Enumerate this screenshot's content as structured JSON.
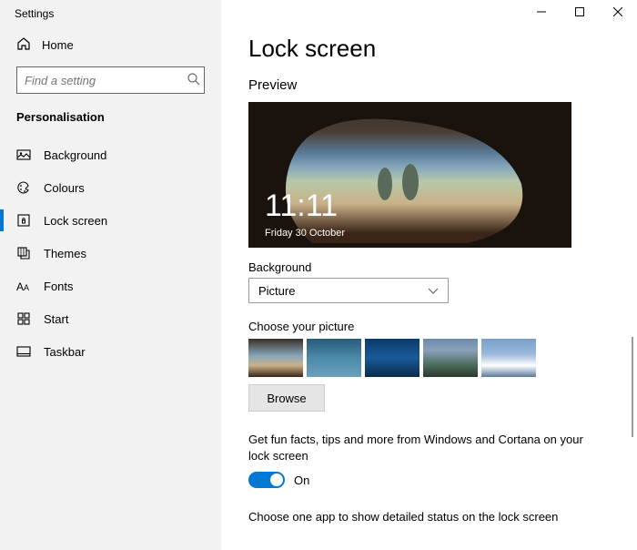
{
  "app_title": "Settings",
  "home_label": "Home",
  "search": {
    "placeholder": "Find a setting"
  },
  "category": "Personalisation",
  "nav": [
    {
      "label": "Background"
    },
    {
      "label": "Colours"
    },
    {
      "label": "Lock screen"
    },
    {
      "label": "Themes"
    },
    {
      "label": "Fonts"
    },
    {
      "label": "Start"
    },
    {
      "label": "Taskbar"
    }
  ],
  "page_title": "Lock screen",
  "preview_label": "Preview",
  "preview": {
    "time": "11:11",
    "date": "Friday 30 October"
  },
  "background": {
    "label": "Background",
    "selected": "Picture"
  },
  "choose_label": "Choose your picture",
  "browse_label": "Browse",
  "tips_text": "Get fun facts, tips and more from Windows and Cortana on your lock screen",
  "tips_toggle": {
    "state": "On"
  },
  "detailed_label": "Choose one app to show detailed status on the lock screen"
}
